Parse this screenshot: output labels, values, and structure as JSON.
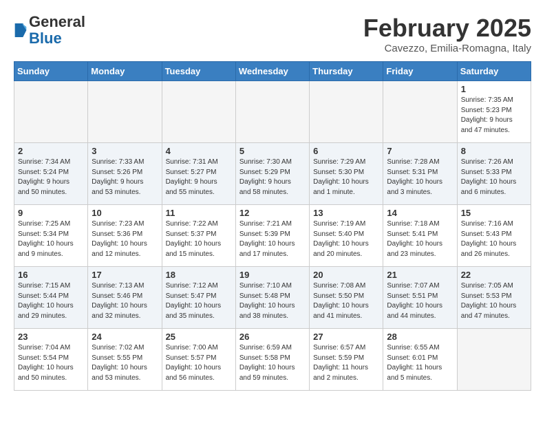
{
  "logo": {
    "general": "General",
    "blue": "Blue"
  },
  "title": "February 2025",
  "location": "Cavezzo, Emilia-Romagna, Italy",
  "weekdays": [
    "Sunday",
    "Monday",
    "Tuesday",
    "Wednesday",
    "Thursday",
    "Friday",
    "Saturday"
  ],
  "weeks": [
    [
      {
        "day": "",
        "info": ""
      },
      {
        "day": "",
        "info": ""
      },
      {
        "day": "",
        "info": ""
      },
      {
        "day": "",
        "info": ""
      },
      {
        "day": "",
        "info": ""
      },
      {
        "day": "",
        "info": ""
      },
      {
        "day": "1",
        "info": "Sunrise: 7:35 AM\nSunset: 5:23 PM\nDaylight: 9 hours\nand 47 minutes."
      }
    ],
    [
      {
        "day": "2",
        "info": "Sunrise: 7:34 AM\nSunset: 5:24 PM\nDaylight: 9 hours\nand 50 minutes."
      },
      {
        "day": "3",
        "info": "Sunrise: 7:33 AM\nSunset: 5:26 PM\nDaylight: 9 hours\nand 53 minutes."
      },
      {
        "day": "4",
        "info": "Sunrise: 7:31 AM\nSunset: 5:27 PM\nDaylight: 9 hours\nand 55 minutes."
      },
      {
        "day": "5",
        "info": "Sunrise: 7:30 AM\nSunset: 5:29 PM\nDaylight: 9 hours\nand 58 minutes."
      },
      {
        "day": "6",
        "info": "Sunrise: 7:29 AM\nSunset: 5:30 PM\nDaylight: 10 hours\nand 1 minute."
      },
      {
        "day": "7",
        "info": "Sunrise: 7:28 AM\nSunset: 5:31 PM\nDaylight: 10 hours\nand 3 minutes."
      },
      {
        "day": "8",
        "info": "Sunrise: 7:26 AM\nSunset: 5:33 PM\nDaylight: 10 hours\nand 6 minutes."
      }
    ],
    [
      {
        "day": "9",
        "info": "Sunrise: 7:25 AM\nSunset: 5:34 PM\nDaylight: 10 hours\nand 9 minutes."
      },
      {
        "day": "10",
        "info": "Sunrise: 7:23 AM\nSunset: 5:36 PM\nDaylight: 10 hours\nand 12 minutes."
      },
      {
        "day": "11",
        "info": "Sunrise: 7:22 AM\nSunset: 5:37 PM\nDaylight: 10 hours\nand 15 minutes."
      },
      {
        "day": "12",
        "info": "Sunrise: 7:21 AM\nSunset: 5:39 PM\nDaylight: 10 hours\nand 17 minutes."
      },
      {
        "day": "13",
        "info": "Sunrise: 7:19 AM\nSunset: 5:40 PM\nDaylight: 10 hours\nand 20 minutes."
      },
      {
        "day": "14",
        "info": "Sunrise: 7:18 AM\nSunset: 5:41 PM\nDaylight: 10 hours\nand 23 minutes."
      },
      {
        "day": "15",
        "info": "Sunrise: 7:16 AM\nSunset: 5:43 PM\nDaylight: 10 hours\nand 26 minutes."
      }
    ],
    [
      {
        "day": "16",
        "info": "Sunrise: 7:15 AM\nSunset: 5:44 PM\nDaylight: 10 hours\nand 29 minutes."
      },
      {
        "day": "17",
        "info": "Sunrise: 7:13 AM\nSunset: 5:46 PM\nDaylight: 10 hours\nand 32 minutes."
      },
      {
        "day": "18",
        "info": "Sunrise: 7:12 AM\nSunset: 5:47 PM\nDaylight: 10 hours\nand 35 minutes."
      },
      {
        "day": "19",
        "info": "Sunrise: 7:10 AM\nSunset: 5:48 PM\nDaylight: 10 hours\nand 38 minutes."
      },
      {
        "day": "20",
        "info": "Sunrise: 7:08 AM\nSunset: 5:50 PM\nDaylight: 10 hours\nand 41 minutes."
      },
      {
        "day": "21",
        "info": "Sunrise: 7:07 AM\nSunset: 5:51 PM\nDaylight: 10 hours\nand 44 minutes."
      },
      {
        "day": "22",
        "info": "Sunrise: 7:05 AM\nSunset: 5:53 PM\nDaylight: 10 hours\nand 47 minutes."
      }
    ],
    [
      {
        "day": "23",
        "info": "Sunrise: 7:04 AM\nSunset: 5:54 PM\nDaylight: 10 hours\nand 50 minutes."
      },
      {
        "day": "24",
        "info": "Sunrise: 7:02 AM\nSunset: 5:55 PM\nDaylight: 10 hours\nand 53 minutes."
      },
      {
        "day": "25",
        "info": "Sunrise: 7:00 AM\nSunset: 5:57 PM\nDaylight: 10 hours\nand 56 minutes."
      },
      {
        "day": "26",
        "info": "Sunrise: 6:59 AM\nSunset: 5:58 PM\nDaylight: 10 hours\nand 59 minutes."
      },
      {
        "day": "27",
        "info": "Sunrise: 6:57 AM\nSunset: 5:59 PM\nDaylight: 11 hours\nand 2 minutes."
      },
      {
        "day": "28",
        "info": "Sunrise: 6:55 AM\nSunset: 6:01 PM\nDaylight: 11 hours\nand 5 minutes."
      },
      {
        "day": "",
        "info": ""
      }
    ]
  ]
}
